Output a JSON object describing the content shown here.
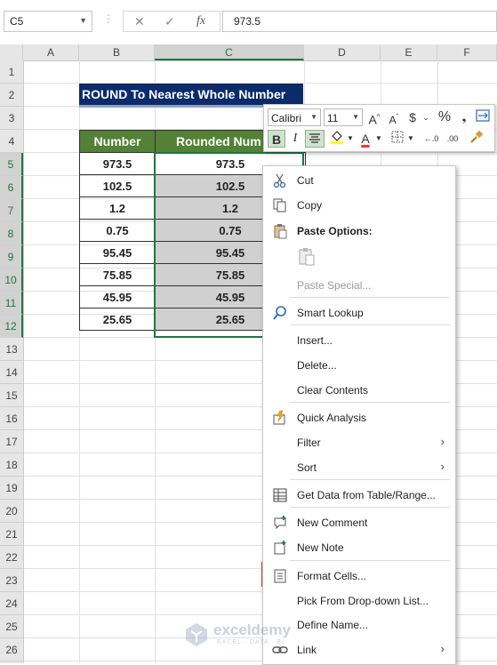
{
  "formula_bar": {
    "name_box": "C5",
    "cancel_icon": "✕",
    "enter_icon": "✓",
    "fx_label": "fx",
    "value": "973.5"
  },
  "columns": [
    "A",
    "B",
    "C",
    "D",
    "E",
    "F"
  ],
  "selected_column": "C",
  "rows": [
    "1",
    "2",
    "3",
    "4",
    "5",
    "6",
    "7",
    "8",
    "9",
    "10",
    "11",
    "12",
    "13",
    "14",
    "15",
    "16",
    "17",
    "18",
    "19",
    "20",
    "21",
    "22",
    "23",
    "24",
    "25",
    "26"
  ],
  "selected_rows": [
    "5",
    "6",
    "7",
    "8",
    "9",
    "10",
    "11",
    "12"
  ],
  "title": "ROUND To Nearest Whole Number",
  "table": {
    "headers": [
      "Number",
      "Rounded Num"
    ],
    "rows": [
      [
        "973.5",
        "973.5"
      ],
      [
        "102.5",
        "102.5"
      ],
      [
        "1.2",
        "1.2"
      ],
      [
        "0.75",
        "0.75"
      ],
      [
        "95.45",
        "95.45"
      ],
      [
        "75.85",
        "75.85"
      ],
      [
        "45.95",
        "45.95"
      ],
      [
        "25.65",
        "25.65"
      ]
    ]
  },
  "mini_toolbar": {
    "font_name": "Calibri",
    "font_size": "11",
    "grow_font": "A^",
    "shrink_font": "Aˇ",
    "currency": "$",
    "percent": "%",
    "bold": "B",
    "italic": "I"
  },
  "context_menu": {
    "items": [
      {
        "label": "Cut",
        "icon": "scissors-icon"
      },
      {
        "label": "Copy",
        "icon": "copy-icon"
      },
      {
        "label": "Paste Options:",
        "icon": "paste-icon"
      },
      {
        "label": "Paste Special...",
        "icon": ""
      },
      {
        "label": "Smart Lookup",
        "icon": "search-icon"
      },
      {
        "label": "Insert...",
        "icon": ""
      },
      {
        "label": "Delete...",
        "icon": ""
      },
      {
        "label": "Clear Contents",
        "icon": ""
      },
      {
        "label": "Quick Analysis",
        "icon": "quick-analysis-icon"
      },
      {
        "label": "Filter",
        "icon": ""
      },
      {
        "label": "Sort",
        "icon": ""
      },
      {
        "label": "Get Data from Table/Range...",
        "icon": "table-icon"
      },
      {
        "label": "New Comment",
        "icon": "comment-icon"
      },
      {
        "label": "New Note",
        "icon": "note-icon"
      },
      {
        "label": "Format Cells...",
        "icon": "format-cells-icon"
      },
      {
        "label": "Pick From Drop-down List...",
        "icon": ""
      },
      {
        "label": "Define Name...",
        "icon": ""
      },
      {
        "label": "Link",
        "icon": "link-icon"
      }
    ],
    "highlighted": "Format Cells..."
  },
  "colors": {
    "header_green": "#538135",
    "title_navy": "#0b2b6b",
    "selection_green": "#217346",
    "highlight_yellow": "#ffff00",
    "highlight_border": "#e53935"
  },
  "watermark": {
    "name": "exceldemy",
    "tagline": "EXCEL · DATA · BI"
  }
}
